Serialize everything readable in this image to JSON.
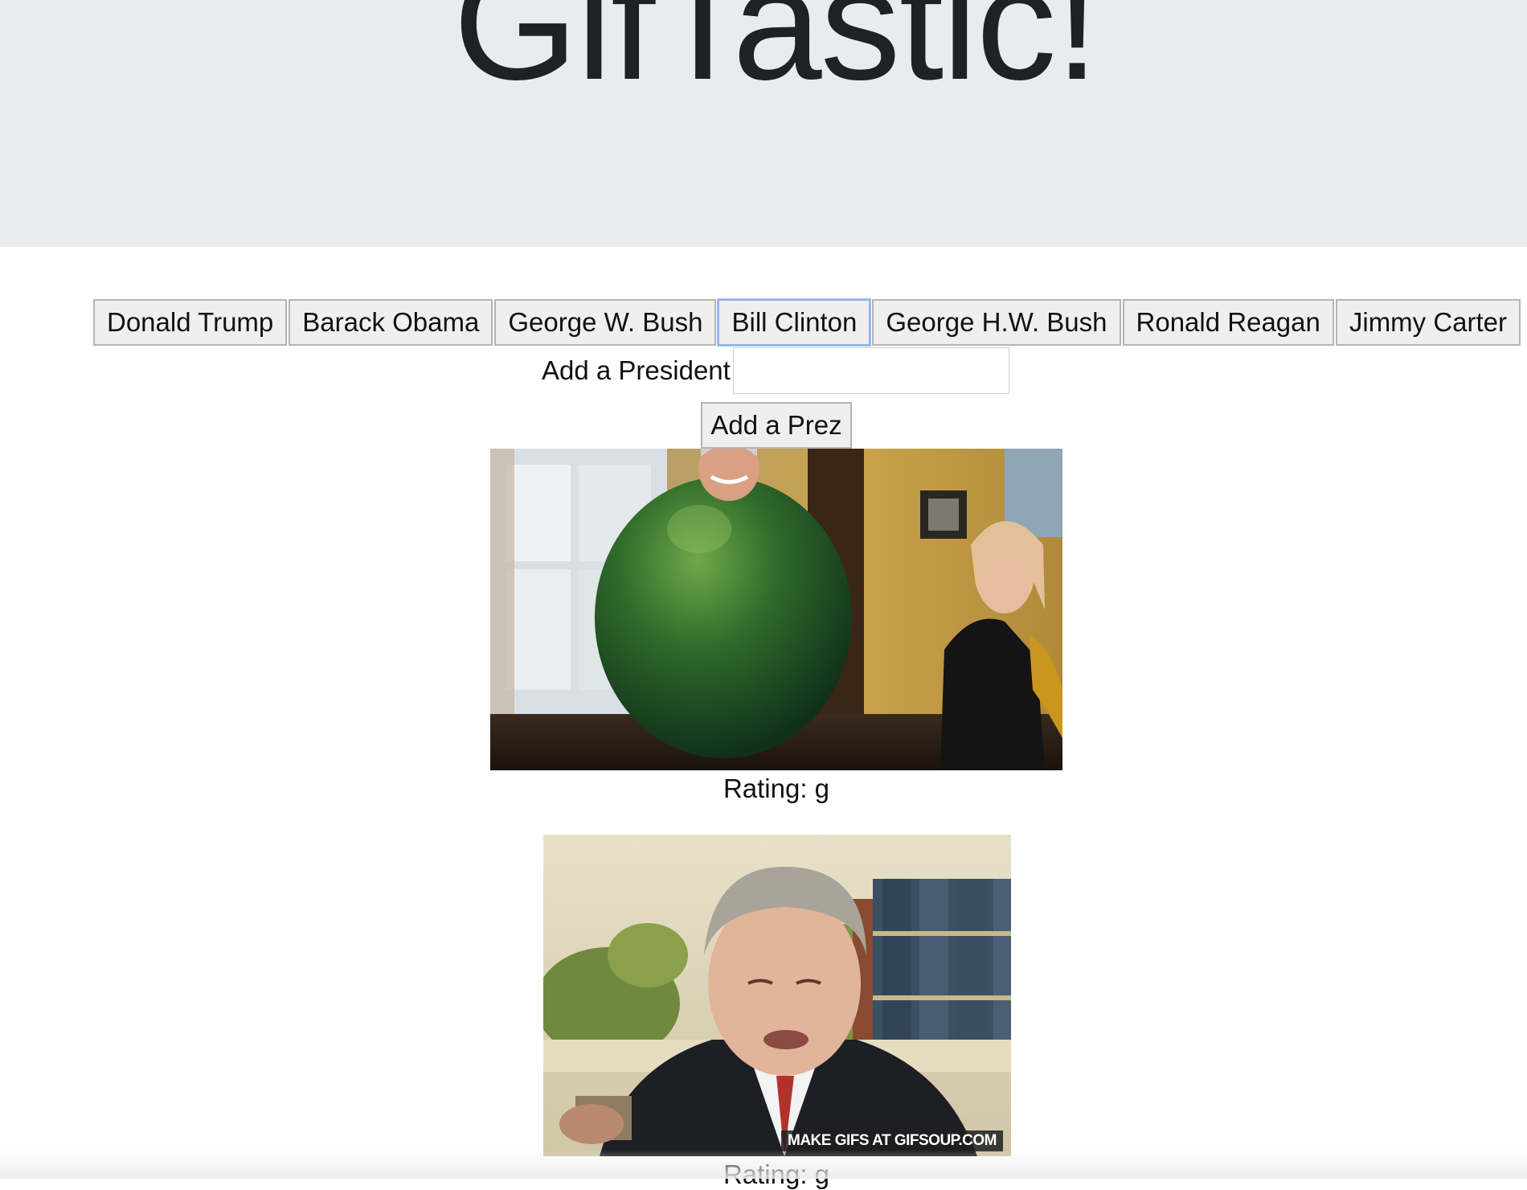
{
  "header": {
    "title": "GifTastic!"
  },
  "president_buttons": [
    {
      "label": "Donald Trump",
      "focused": false
    },
    {
      "label": "Barack Obama",
      "focused": false
    },
    {
      "label": "George W. Bush",
      "focused": false
    },
    {
      "label": "Bill Clinton",
      "focused": true
    },
    {
      "label": "George H.W. Bush",
      "focused": false
    },
    {
      "label": "Ronald Reagan",
      "focused": false
    },
    {
      "label": "Jimmy Carter",
      "focused": false
    }
  ],
  "add_form": {
    "label": "Add a President",
    "input_value": "",
    "input_placeholder": "",
    "submit_label": "Add a Prez"
  },
  "gifs": [
    {
      "rating_text": "Rating: g",
      "watermark": ""
    },
    {
      "rating_text": "Rating: g",
      "watermark": "MAKE GIFS AT GIFSOUP.COM"
    }
  ],
  "colors": {
    "jumbotron_bg": "#e9ecef",
    "title_color": "#1e2125",
    "button_bg": "#efefef",
    "focus_ring": "#8fb2e6"
  }
}
